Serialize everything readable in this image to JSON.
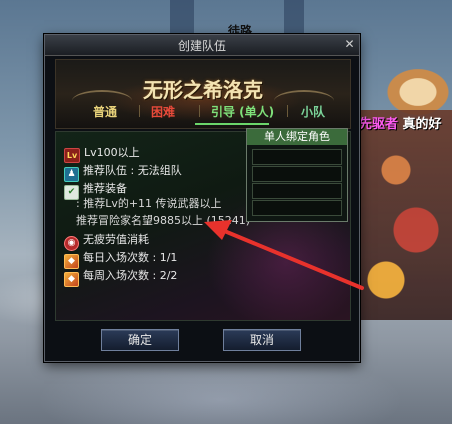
{
  "dialog": {
    "title": "创建队伍",
    "close_glyph": "✕",
    "dungeon_name": "无形之希洛克",
    "tabs": [
      {
        "label": "普通"
      },
      {
        "label": "困难"
      },
      {
        "label": "引导 (单人)"
      },
      {
        "label": "小队"
      }
    ],
    "info": {
      "level_badge": "Lv",
      "level": "Lv100以上",
      "recommend_party": "推荐队伍 : 无法组队",
      "recommend_equip_label": "推荐装备",
      "recommend_equip_detail": ": 推荐Lv的+11 传说武器以上",
      "recommend_fame": "推荐冒险家名望9885以上 (15241)",
      "fatigue": "无疲劳值消耗",
      "daily_entries": "每日入场次数 : 1/1",
      "weekly_entries": "每周入场次数 : 2/2"
    },
    "side_panel": {
      "header": "单人绑定角色"
    },
    "buttons": {
      "ok": "确定",
      "cancel": "取消"
    }
  },
  "background": {
    "top_label": "徒路",
    "ally_name_highlight": "先驱者",
    "ally_name_tail": "真的好"
  },
  "colors": {
    "tab_normal": "#e8d27a",
    "tab_hard": "#e84a3a",
    "tab_guide_active": "#7ee07a",
    "tab_squad": "#7bd49a",
    "arrow": "#e8322c"
  },
  "icons": [
    "level-icon",
    "party-icon",
    "equipment-icon",
    "fatigue-icon",
    "daily-entry-icon",
    "weekly-entry-icon",
    "close-icon"
  ]
}
